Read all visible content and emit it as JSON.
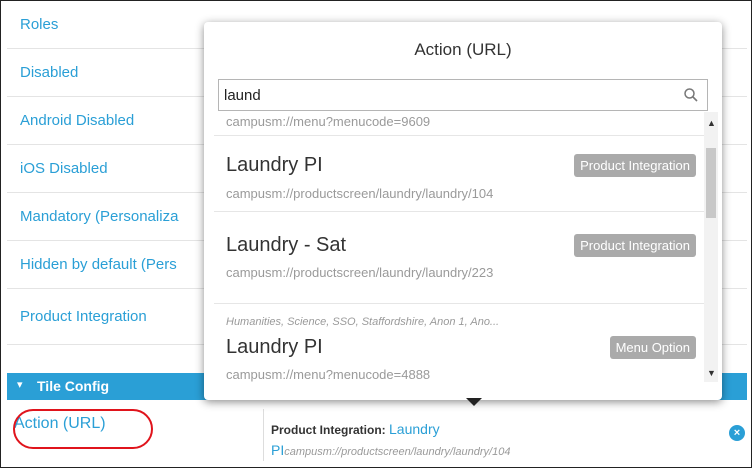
{
  "properties": [
    {
      "label": "Roles"
    },
    {
      "label": "Disabled"
    },
    {
      "label": "Android Disabled"
    },
    {
      "label": "iOS Disabled"
    },
    {
      "label": "Mandatory (Personaliza"
    },
    {
      "label": "Hidden by default (Pers"
    },
    {
      "label": "Product Integration"
    }
  ],
  "section": {
    "label": "Tile Config",
    "caret": "▾"
  },
  "action": {
    "key": "Action (URL)",
    "value_prefix": "Product Integration:",
    "value_link_part1": "Laundry",
    "value_link_part2": "PI",
    "value_url": "campusm://productscreen/laundry/laundry/104",
    "clear_glyph": "×"
  },
  "popup": {
    "title": "Action (URL)",
    "search_value": "laund",
    "results": [
      {
        "url": "campusm://menu?menucode=9609"
      },
      {
        "title": "Laundry PI",
        "url": "campusm://productscreen/laundry/laundry/104",
        "badge": "Product Integration"
      },
      {
        "title": "Laundry - Sat",
        "url": "campusm://productscreen/laundry/laundry/223",
        "badge": "Product Integration"
      },
      {
        "meta": "Humanities, Science, SSO, Staffordshire, Anon 1, Ano...",
        "title": "Laundry PI",
        "url": "campusm://menu?menucode=4888",
        "badge": "Menu Option"
      }
    ]
  },
  "scroll": {
    "up": "▲",
    "down": "▼"
  }
}
